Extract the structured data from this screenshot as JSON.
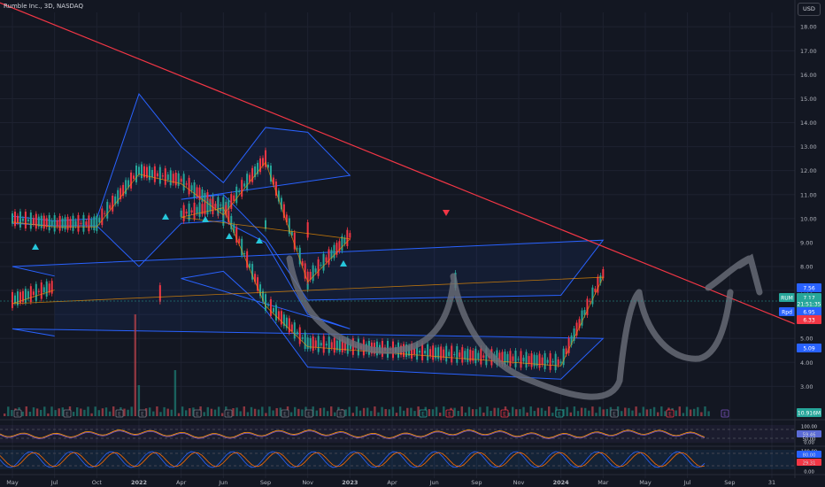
{
  "header": {
    "title": "Rumble Inc., 3D, NASDAQ",
    "currency": "USD"
  },
  "chart_data": {
    "type": "line",
    "title": "Rumble Inc., 3D, NASDAQ",
    "x_ticks": [
      "May",
      "Jul",
      "Oct",
      "2022",
      "Apr",
      "Jun",
      "Sep",
      "Nov",
      "2023",
      "Apr",
      "Jun",
      "Sep",
      "Nov",
      "2024",
      "Mar",
      "May",
      "Jul",
      "Sep",
      "31"
    ],
    "y_ticks": [
      "18.00",
      "17.00",
      "16.00",
      "15.00",
      "14.00",
      "13.00",
      "12.00",
      "11.00",
      "10.00",
      "9.00",
      "8.00",
      "7.00",
      "6.00",
      "5.00",
      "4.00",
      "3.00"
    ],
    "ylim": [
      2.2,
      18.6
    ],
    "series": [
      {
        "name": "",
        "color": "#26a69a",
        "x": [
          "May",
          "Jul",
          "Oct",
          "2022",
          "Apr",
          "Jun",
          "Sep",
          "Nov",
          "2023",
          "Apr",
          "Jun",
          "Sep",
          "Nov",
          "2024",
          "Mar",
          "May",
          "Jul"
        ],
        "values": [
          10.0,
          9.8,
          9.8,
          12.0,
          11.6,
          10.3,
          12.5,
          7.5,
          9.3,
          10.2,
          10.6,
          6.5,
          4.8,
          4.0,
          7.7,
          6.6,
          7.17
        ]
      }
    ],
    "upper_band": [
      10.1,
      9.9,
      10.0,
      15.2,
      13.0,
      11.5,
      13.8,
      13.6,
      11.8,
      10.8,
      11.0,
      9.2,
      6.6,
      6.8,
      9.1,
      8.0,
      7.6
    ],
    "lower_band": [
      9.8,
      9.7,
      9.7,
      8.0,
      9.8,
      9.9,
      9.0,
      6.0,
      5.4,
      7.5,
      7.8,
      6.2,
      3.8,
      3.3,
      5.0,
      5.4,
      5.1
    ],
    "trendline": [
      {
        "x": "start",
        "y": 19.0
      },
      {
        "x": "end",
        "y": 5.6
      }
    ],
    "price_labels": [
      {
        "value": "7.56",
        "color": "#2962ff"
      },
      {
        "value": "RUM",
        "color": "#26a69a"
      },
      {
        "value": "7.17",
        "color": "#26a69a"
      },
      {
        "value": "21:51:35",
        "color": "#26a69a"
      },
      {
        "value": "Rpd",
        "color": "#2962ff"
      },
      {
        "value": "6.95",
        "color": "#2962ff"
      },
      {
        "value": "6.33",
        "color": "#f23645"
      },
      {
        "value": "5.09",
        "color": "#2962ff"
      },
      {
        "value": "10.916M",
        "color": "#26a69a"
      }
    ],
    "rsi_labels": [
      {
        "value": "100.00",
        "color": "#131722"
      },
      {
        "value": "59.46",
        "color": "#5b6bd5"
      },
      {
        "value": "50.00",
        "color": "#131722"
      },
      {
        "value": "0.00",
        "color": "#131722"
      }
    ],
    "stoch_labels": [
      {
        "value": "100.00",
        "color": "#131722"
      },
      {
        "value": "80.00",
        "color": "#2962ff"
      },
      {
        "value": "29.31",
        "color": "#f23645"
      },
      {
        "value": "0.00",
        "color": "#131722"
      }
    ],
    "earnings_markers": [
      "E",
      "E",
      "E",
      "E",
      "E",
      "E",
      "E",
      "E",
      "E",
      "E",
      "E",
      "E",
      "E",
      "E",
      "E",
      "E"
    ]
  }
}
